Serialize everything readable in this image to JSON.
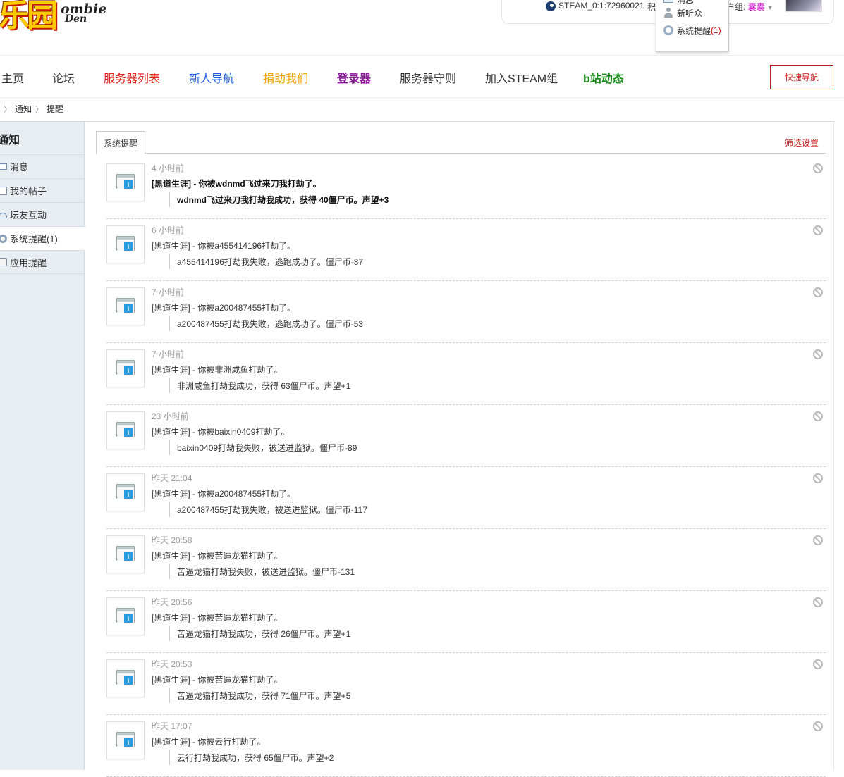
{
  "header": {
    "logo_main": "乐园",
    "logo_sub1": "ombie",
    "logo_sub2": "Den",
    "steam_id": "STEAM_0:1:72960021",
    "frag1": "积",
    "group_label": "户组:",
    "group_value": "囊囊",
    "dropdown": {
      "items": [
        {
          "label": "消息",
          "icon": "mail-icon"
        },
        {
          "label": "新听众",
          "icon": "user-icon"
        },
        {
          "label": "系统提醒",
          "count": "(1)",
          "icon": "gear-icon"
        }
      ]
    }
  },
  "nav": {
    "items": [
      {
        "label": "主页",
        "color": "#333333"
      },
      {
        "label": "论坛",
        "color": "#333333"
      },
      {
        "label": "服务器列表",
        "color": "#e0261b"
      },
      {
        "label": "新人导航",
        "color": "#1d5bd8"
      },
      {
        "label": "捐助我们",
        "color": "#f3a100"
      },
      {
        "label": "登录器",
        "color": "#8a1a9a"
      },
      {
        "label": "服务器守则",
        "color": "#333333"
      },
      {
        "label": "加入STEAM组",
        "color": "#333333"
      },
      {
        "label": "b站动态",
        "color": "#1b8c1b"
      }
    ],
    "quick_nav": "快捷导航"
  },
  "breadcrumb": [
    "通知",
    "提醒"
  ],
  "sidebar": {
    "title": "通知",
    "items": [
      {
        "label": "消息",
        "icon": "mail-icon"
      },
      {
        "label": "我的帖子",
        "icon": "doc-icon"
      },
      {
        "label": "坛友互动",
        "icon": "cloud-icon"
      },
      {
        "label": "系统提醒(1)",
        "icon": "gear-icon",
        "active": true
      },
      {
        "label": "应用提醒",
        "icon": "bell-icon"
      }
    ]
  },
  "main": {
    "tab": "系统提醒",
    "filter": "筛选设置",
    "notifications": [
      {
        "time": "4 小时前",
        "title": "[黑道生涯] - 你被wdnmd飞过来刀我打劫了。",
        "detail": "wdnmd飞过来刀我打劫我成功，获得 40僵尸币。声望+3",
        "new": true
      },
      {
        "time": "6 小时前",
        "title": "[黑道生涯] - 你被a455414196打劫了。",
        "detail": "a455414196打劫我失败，逃跑成功了。僵尸币-87",
        "new": false
      },
      {
        "time": "7 小时前",
        "title": "[黑道生涯] - 你被a200487455打劫了。",
        "detail": "a200487455打劫我失败，逃跑成功了。僵尸币-53",
        "new": false
      },
      {
        "time": "7 小时前",
        "title": "[黑道生涯] - 你被非洲咸鱼打劫了。",
        "detail": "非洲咸鱼打劫我成功，获得 63僵尸币。声望+1",
        "new": false
      },
      {
        "time": "23 小时前",
        "title": "[黑道生涯] - 你被baixin0409打劫了。",
        "detail": "baixin0409打劫我失败，被送进监狱。僵尸币-89",
        "new": false
      },
      {
        "time": "昨天 21:04",
        "title": "[黑道生涯] - 你被a200487455打劫了。",
        "detail": "a200487455打劫我失败，被送进监狱。僵尸币-117",
        "new": false
      },
      {
        "time": "昨天 20:58",
        "title": "[黑道生涯] - 你被苦逼龙猫打劫了。",
        "detail": "苦逼龙猫打劫我失败，被送进监狱。僵尸币-131",
        "new": false
      },
      {
        "time": "昨天 20:56",
        "title": "[黑道生涯] - 你被苦逼龙猫打劫了。",
        "detail": "苦逼龙猫打劫我成功，获得 26僵尸币。声望+1",
        "new": false
      },
      {
        "time": "昨天 20:53",
        "title": "[黑道生涯] - 你被苦逼龙猫打劫了。",
        "detail": "苦逼龙猫打劫我成功，获得 71僵尸币。声望+5",
        "new": false
      },
      {
        "time": "昨天 17:07",
        "title": "[黑道生涯] - 你被云行打劫了。",
        "detail": "云行打劫我成功，获得 65僵尸币。声望+2",
        "new": false
      }
    ]
  }
}
